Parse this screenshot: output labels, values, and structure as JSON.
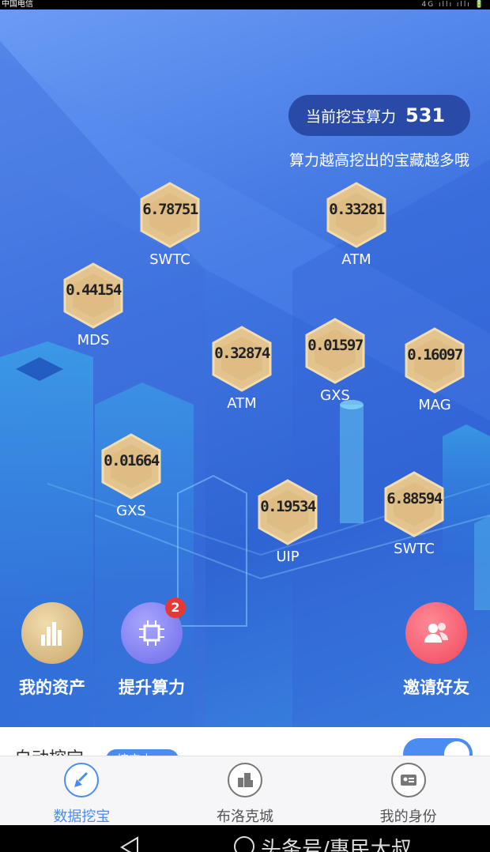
{
  "status_bar": {
    "carrier": "中国电信",
    "right": "4G ıllı ıllı 🔋"
  },
  "header": {
    "power_label": "当前挖宝算力",
    "power_value": "531",
    "hint": "算力越高挖出的宝藏越多哦"
  },
  "coins": [
    {
      "amount": "6.78751",
      "name": "SWTC"
    },
    {
      "amount": "0.33281",
      "name": "ATM"
    },
    {
      "amount": "0.44154",
      "name": "MDS"
    },
    {
      "amount": "0.32874",
      "name": "ATM"
    },
    {
      "amount": "0.01597",
      "name": "GXS"
    },
    {
      "amount": "0.16097",
      "name": "MAG"
    },
    {
      "amount": "0.01664",
      "name": "GXS"
    },
    {
      "amount": "0.19534",
      "name": "UIP"
    },
    {
      "amount": "6.88594",
      "name": "SWTC"
    }
  ],
  "actions": {
    "assets": {
      "label": "我的资产",
      "icon": "bar-stack-icon"
    },
    "boost": {
      "label": "提升算力",
      "icon": "chip-icon",
      "badge": "2"
    },
    "invite": {
      "label": "邀请好友",
      "icon": "users-icon"
    }
  },
  "auto_mining": {
    "label": "自动挖宝",
    "chip": "挖宝中",
    "enabled": true
  },
  "tabs": [
    {
      "label": "数据挖宝",
      "icon": "shovel-icon",
      "active": true
    },
    {
      "label": "布洛克城",
      "icon": "city-icon",
      "active": false
    },
    {
      "label": "我的身份",
      "icon": "id-card-icon",
      "active": false
    }
  ],
  "nav_bar": {
    "watermark": "头条号/惠民大叔"
  },
  "colors": {
    "accent": "#4a8cf0",
    "pill": "#2a4aa8",
    "badge": "#e53935",
    "coin": "#e3c48e"
  }
}
